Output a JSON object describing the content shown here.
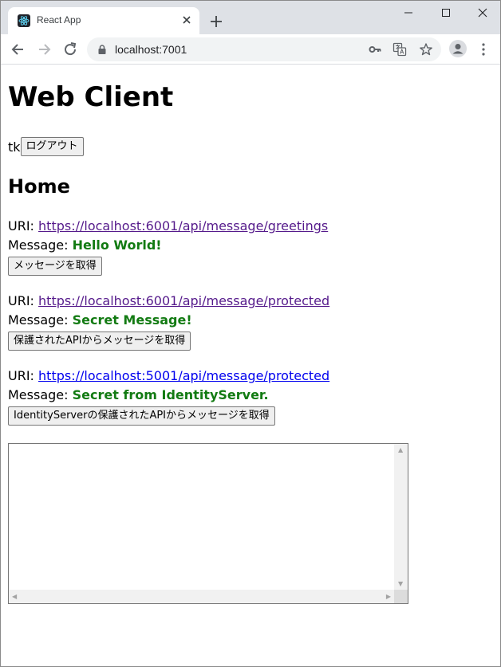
{
  "browser": {
    "tab_title": "React App",
    "url": "localhost:7001"
  },
  "page": {
    "title": "Web Client",
    "username": "tk",
    "logout_label": "ログアウト",
    "section_title": "Home",
    "uri_label": "URI: ",
    "message_label": "Message: ",
    "requests": [
      {
        "uri": "https://localhost:6001/api/message/greetings",
        "message": "Hello World!",
        "button": "メッセージを取得"
      },
      {
        "uri": "https://localhost:6001/api/message/protected",
        "message": "Secret Message!",
        "button": "保護されたAPIからメッセージを取得"
      },
      {
        "uri": "https://localhost:5001/api/message/protected",
        "message": "Secret from IdentityServer.",
        "button": "IdentityServerの保護されたAPIからメッセージを取得"
      }
    ],
    "output_text": ""
  },
  "colors": {
    "tabstrip": "#dee1e6",
    "visited_link": "#551a8b",
    "link": "#0000ee",
    "message": "#137b13"
  }
}
